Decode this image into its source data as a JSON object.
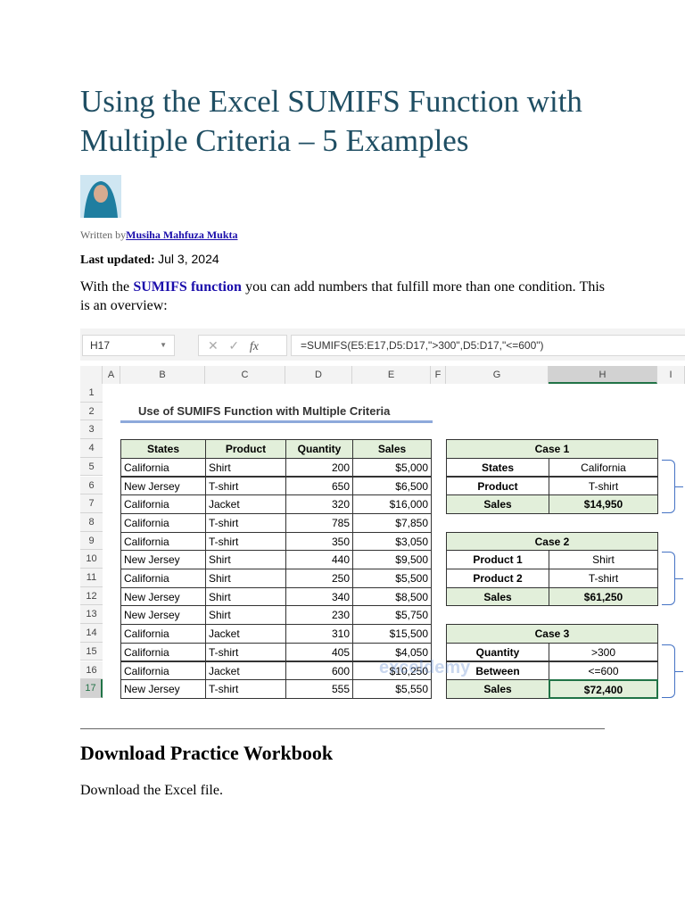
{
  "article": {
    "title": "Using the Excel SUMIFS Function with Multiple Criteria – 5 Examples",
    "written_by_prefix": "Written by",
    "author": "Musiha Mahfuza Mukta",
    "last_updated_label": "Last updated:",
    "last_updated": "Jul 3, 2024",
    "intro_before": "With the",
    "intro_link": "SUMIFS function",
    "intro_after": "you can add numbers that fulfill more than one condition. This is an overview:"
  },
  "sheet": {
    "name_box": "H17",
    "fx": "fx",
    "formula": "=SUMIFS(E5:E17,D5:D17,\">300\",D5:D17,\"<=600\")",
    "columns": [
      "A",
      "B",
      "C",
      "D",
      "E",
      "F",
      "G",
      "H",
      "I"
    ],
    "sheet_title": "Use of SUMIFS Function with Multiple Criteria",
    "headers": [
      "States",
      "Product",
      "Quantity",
      "Sales"
    ],
    "rows": [
      [
        "California",
        "Shirt",
        "200",
        "$5,000"
      ],
      [
        "New Jersey",
        "T-shirt",
        "650",
        "$6,500"
      ],
      [
        "California",
        "Jacket",
        "320",
        "$16,000"
      ],
      [
        "California",
        "T-shirt",
        "785",
        "$7,850"
      ],
      [
        "California",
        "T-shirt",
        "350",
        "$3,050"
      ],
      [
        "New Jersey",
        "Shirt",
        "440",
        "$9,500"
      ],
      [
        "California",
        "Shirt",
        "250",
        "$5,500"
      ],
      [
        "New Jersey",
        "Shirt",
        "340",
        "$8,500"
      ],
      [
        "New Jersey",
        "Shirt",
        "230",
        "$5,750"
      ],
      [
        "California",
        "Jacket",
        "310",
        "$15,500"
      ],
      [
        "California",
        "T-shirt",
        "405",
        "$4,050"
      ],
      [
        "California",
        "Jacket",
        "600",
        "$10,250"
      ],
      [
        "New Jersey",
        "T-shirt",
        "555",
        "$5,550"
      ]
    ],
    "cases": [
      {
        "title": "Case 1",
        "rows": [
          [
            "States",
            "California"
          ],
          [
            "Product",
            "T-shirt"
          ],
          [
            "Sales",
            "$14,950"
          ]
        ]
      },
      {
        "title": "Case 2",
        "rows": [
          [
            "Product 1",
            "Shirt"
          ],
          [
            "Product 2",
            "T-shirt"
          ],
          [
            "Sales",
            "$61,250"
          ]
        ]
      },
      {
        "title": "Case 3",
        "rows": [
          [
            "Quantity",
            "&gt;300"
          ],
          [
            "Between",
            "<=600"
          ],
          [
            "Sales",
            "$72,400"
          ]
        ]
      }
    ],
    "watermark": "exceldemy"
  },
  "download": {
    "heading": "Download Practice Workbook",
    "text": "Download the Excel file."
  },
  "colors": {
    "title": "#1f4e63",
    "header_fill": "#e2efda",
    "link": "#1a0dab"
  }
}
